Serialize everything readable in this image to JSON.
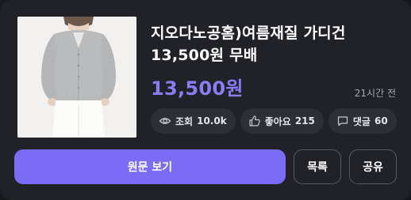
{
  "post": {
    "title_line1": "지오다노공홈)여름재질 가디건",
    "title_line2": "13,500원 무배",
    "price": "13,500원",
    "time_ago": "21시간 전"
  },
  "stats": {
    "views_label": "조회",
    "views_value": "10.0k",
    "likes_label": "좋아요",
    "likes_value": "215",
    "comments_label": "댓글",
    "comments_value": "60"
  },
  "buttons": {
    "view_original": "원문 보기",
    "list": "목록",
    "share": "공유"
  },
  "icons": {
    "views": "eye-icon",
    "likes": "thumbs-up-icon",
    "comments": "comment-icon"
  },
  "colors": {
    "accent": "#7b6cf6",
    "price": "#8b7cf6",
    "card_bg": "#212228",
    "chip_bg": "#2d2f37"
  }
}
